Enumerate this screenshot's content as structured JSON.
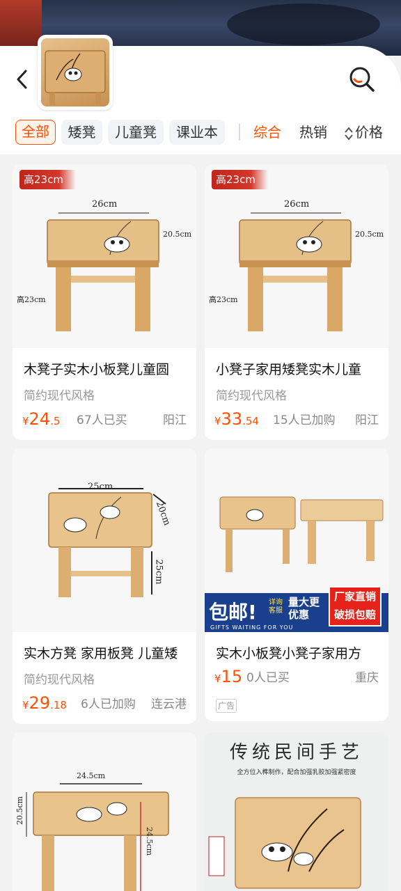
{
  "colors": {
    "accent": "#ff5000",
    "chip_bg": "#f1f3f6"
  },
  "header": {
    "back_icon": "chevron-left-icon",
    "search_icon": "search-icon"
  },
  "filters": {
    "chips": [
      "全部",
      "矮凳",
      "儿童凳",
      "课业本"
    ],
    "sorts": [
      "综合",
      "热销",
      "价格"
    ],
    "active_chip": "全部",
    "active_sort": "综合"
  },
  "products": [
    {
      "badge": "高23cm",
      "dims": {
        "width": "26cm",
        "depth": "20.5cm",
        "height": "高23cm"
      },
      "title": "木凳子实木小板凳儿童圆",
      "subtitle": "简约现代风格",
      "price_symbol": "¥",
      "price_int": "24",
      "price_dec": ".5",
      "sold": "67人已买",
      "location": "阳江"
    },
    {
      "badge": "高23cm",
      "dims": {
        "width": "26cm",
        "depth": "20.5cm",
        "height": "高23cm"
      },
      "title": "小凳子家用矮凳实木儿童",
      "subtitle": "简约现代风格",
      "price_symbol": "¥",
      "price_int": "33",
      "price_dec": ".54",
      "sold": "15人已加购",
      "location": "阳江"
    },
    {
      "dims": {
        "width": "25cm",
        "depth": "20cm",
        "height": "25cm"
      },
      "title": "实木方凳 家用板凳 儿童矮",
      "subtitle": "简约现代风格",
      "price_symbol": "¥",
      "price_int": "29",
      "price_dec": ".18",
      "sold": "6人已加购",
      "location": "连云港"
    },
    {
      "promo": {
        "big": "包邮!",
        "small": "详询客服",
        "mid": "量大更优惠",
        "red": "厂家直销破损包赔",
        "eng": "GIFTS WAITING FOR YOU"
      },
      "title": "实木小板凳小凳子家用方",
      "price_symbol": "¥",
      "price_int": "15",
      "price_dec": "",
      "sold": "0人已买",
      "location": "重庆",
      "ad_tag": "广告"
    },
    {
      "dims": {
        "width": "24.5cm",
        "depth": "20.5cm",
        "height": "24.5cm"
      }
    },
    {
      "craft_title": "传统民间手艺",
      "craft_sub": "全方位入榫制作，配合加强乳胶加强紧密度"
    }
  ]
}
